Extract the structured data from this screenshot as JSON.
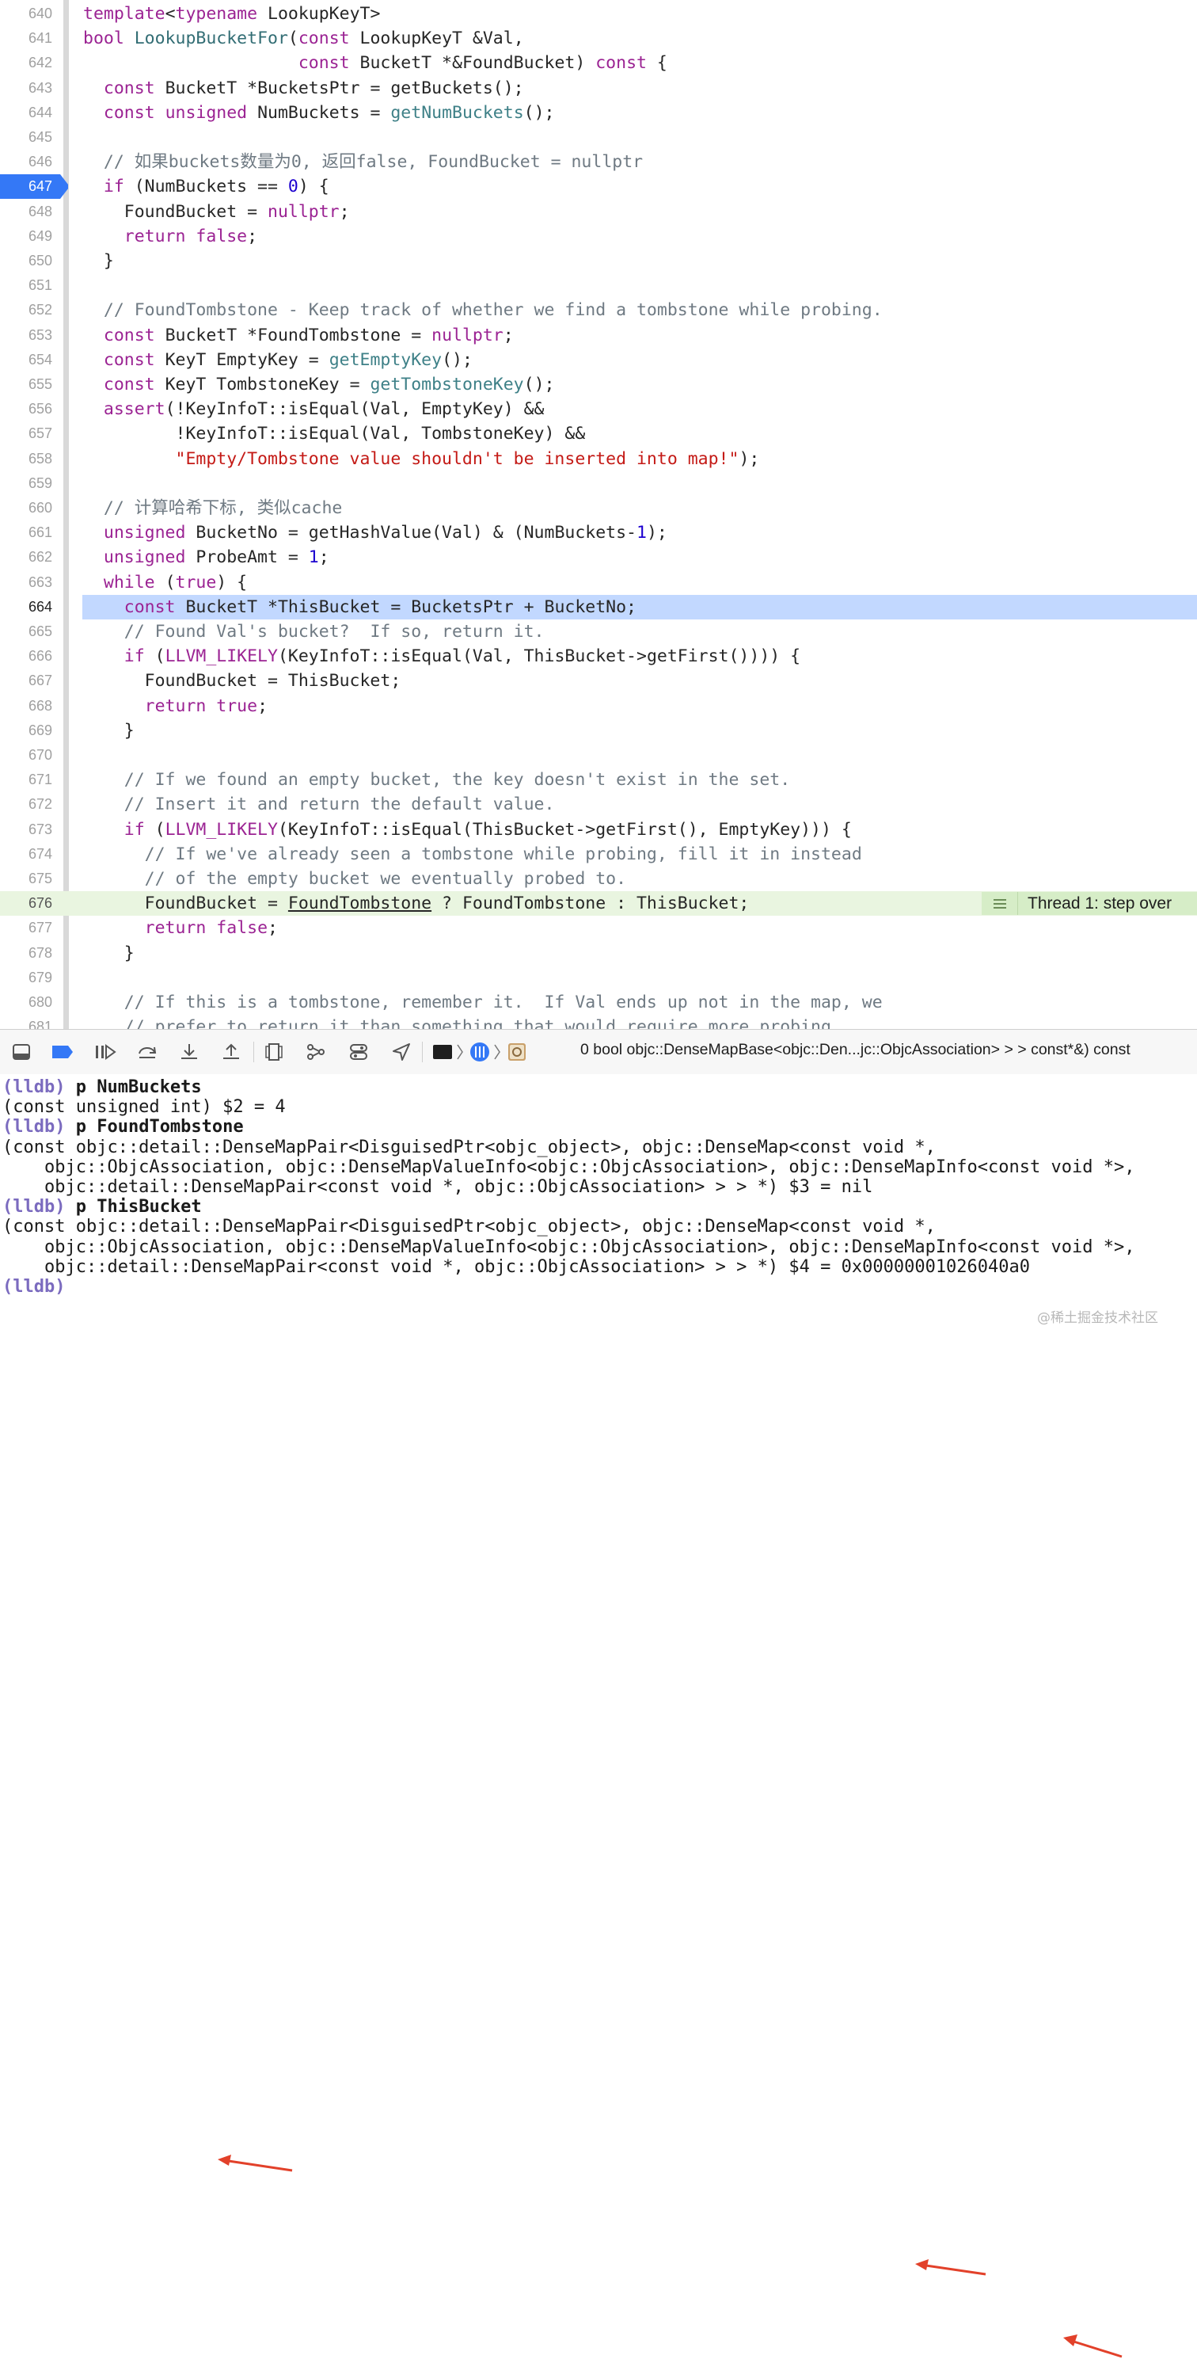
{
  "editor": {
    "lines": [
      {
        "num": "640",
        "code": "<span class=\"k\">template</span>&lt;<span class=\"k\">typename</span> LookupKeyT&gt;"
      },
      {
        "num": "641",
        "code": "<span class=\"k\">bool</span> <span class=\"fb\">LookupBucketFor</span>(<span class=\"k\">const</span> LookupKeyT &amp;Val,"
      },
      {
        "num": "642",
        "code": "                     <span class=\"k\">const</span> BucketT *&amp;FoundBucket) <span class=\"k\">const</span> {"
      },
      {
        "num": "643",
        "code": "  <span class=\"k\">const</span> BucketT *BucketsPtr = getBuckets();"
      },
      {
        "num": "644",
        "code": "  <span class=\"k\">const</span> <span class=\"k\">unsigned</span> NumBuckets = <span class=\"f\">getNumBuckets</span>();"
      },
      {
        "num": "645",
        "code": ""
      },
      {
        "num": "646",
        "code": "  <span class=\"c\">// 如果buckets数量为0, 返回false, FoundBucket = nullptr</span>"
      },
      {
        "num": "647",
        "code": "  <span class=\"k\">if</span> (NumBuckets == <span class=\"n\">0</span>) {"
      },
      {
        "num": "648",
        "code": "    FoundBucket = <span class=\"k\">nullptr</span>;"
      },
      {
        "num": "649",
        "code": "    <span class=\"k\">return</span> <span class=\"k\">false</span>;"
      },
      {
        "num": "650",
        "code": "  }"
      },
      {
        "num": "651",
        "code": ""
      },
      {
        "num": "652",
        "code": "  <span class=\"c\">// FoundTombstone - Keep track of whether we find a tombstone while probing.</span>"
      },
      {
        "num": "653",
        "code": "  <span class=\"k\">const</span> BucketT *FoundTombstone = <span class=\"k\">nullptr</span>;"
      },
      {
        "num": "654",
        "code": "  <span class=\"k\">const</span> KeyT EmptyKey = <span class=\"f\">getEmptyKey</span>();"
      },
      {
        "num": "655",
        "code": "  <span class=\"k\">const</span> KeyT TombstoneKey = <span class=\"f\">getTombstoneKey</span>();"
      },
      {
        "num": "656",
        "code": "  <span class=\"k\">assert</span>(!KeyInfoT::isEqual(Val, EmptyKey) &amp;&amp;"
      },
      {
        "num": "657",
        "code": "         !KeyInfoT::isEqual(Val, TombstoneKey) &amp;&amp;"
      },
      {
        "num": "658",
        "code": "         <span class=\"s\">\"Empty/Tombstone value shouldn't be inserted into map!\"</span>);"
      },
      {
        "num": "659",
        "code": ""
      },
      {
        "num": "660",
        "code": "  <span class=\"c\">// 计算哈希下标, 类似cache</span>"
      },
      {
        "num": "661",
        "code": "  <span class=\"k\">unsigned</span> BucketNo = getHashValue(Val) &amp; (NumBuckets-<span class=\"n\">1</span>);"
      },
      {
        "num": "662",
        "code": "  <span class=\"k\">unsigned</span> ProbeAmt = <span class=\"n\">1</span>;"
      },
      {
        "num": "663",
        "code": "  <span class=\"k\">while</span> (<span class=\"k\">true</span>) {"
      },
      {
        "num": "664",
        "code": "    <span class=\"k\">const</span> BucketT *ThisBucket = BucketsPtr + BucketNo;"
      },
      {
        "num": "665",
        "code": "    <span class=\"c\">// Found Val's bucket?  If so, return it.</span>"
      },
      {
        "num": "666",
        "code": "    <span class=\"k\">if</span> (<span class=\"k\">LLVM_LIKELY</span>(KeyInfoT::isEqual(Val, ThisBucket-&gt;getFirst()))) {"
      },
      {
        "num": "667",
        "code": "      FoundBucket = ThisBucket;"
      },
      {
        "num": "668",
        "code": "      <span class=\"k\">return</span> <span class=\"k\">true</span>;"
      },
      {
        "num": "669",
        "code": "    }"
      },
      {
        "num": "670",
        "code": ""
      },
      {
        "num": "671",
        "code": "    <span class=\"c\">// If we found an empty bucket, the key doesn't exist in the set.</span>"
      },
      {
        "num": "672",
        "code": "    <span class=\"c\">// Insert it and return the default value.</span>"
      },
      {
        "num": "673",
        "code": "    <span class=\"k\">if</span> (<span class=\"k\">LLVM_LIKELY</span>(KeyInfoT::isEqual(ThisBucket-&gt;getFirst(), EmptyKey))) {"
      },
      {
        "num": "674",
        "code": "      <span class=\"c\">// If we've already seen a tombstone while probing, fill it in instead</span>"
      },
      {
        "num": "675",
        "code": "      <span class=\"c\">// of the empty bucket we eventually probed to.</span>"
      },
      {
        "num": "676",
        "code": "      FoundBucket = <span class=\"u\">FoundTombstone</span> ? FoundTombstone : ThisBucket;"
      },
      {
        "num": "677",
        "code": "      <span class=\"k\">return</span> <span class=\"k\">false</span>;"
      },
      {
        "num": "678",
        "code": "    }"
      },
      {
        "num": "679",
        "code": ""
      },
      {
        "num": "680",
        "code": "    <span class=\"c\">// If this is a tombstone, remember it.  If Val ends up not in the map, we</span>"
      },
      {
        "num": "681",
        "code": "    <span class=\"c\">// prefer to return it than something that would require more probing.</span>"
      }
    ],
    "breakpoint_line": "647",
    "current_line": "664",
    "pc_line": "676",
    "thread_badge": "Thread 1: step over"
  },
  "debug_toolbar": {
    "frame_label": "0 bool objc::DenseMapBase<objc::Den...jc::ObjcAssociation> > > const*&) const"
  },
  "console": {
    "lines": [
      {
        "prompt": "(lldb)",
        "text": " p NumBuckets"
      },
      {
        "prompt": "",
        "text": "(const unsigned int) $2 = 4"
      },
      {
        "prompt": "(lldb)",
        "text": " p FoundTombstone"
      },
      {
        "prompt": "",
        "text": "(const objc::detail::DenseMapPair<DisguisedPtr<objc_object>, objc::DenseMap<const void *,"
      },
      {
        "prompt": "",
        "text": "    objc::ObjcAssociation, objc::DenseMapValueInfo<objc::ObjcAssociation>, objc::DenseMapInfo<const void *>,"
      },
      {
        "prompt": "",
        "text": "    objc::detail::DenseMapPair<const void *, objc::ObjcAssociation> > > *) $3 = nil"
      },
      {
        "prompt": "(lldb)",
        "text": " p ThisBucket"
      },
      {
        "prompt": "",
        "text": "(const objc::detail::DenseMapPair<DisguisedPtr<objc_object>, objc::DenseMap<const void *,"
      },
      {
        "prompt": "",
        "text": "    objc::ObjcAssociation, objc::DenseMapValueInfo<objc::ObjcAssociation>, objc::DenseMapInfo<const void *>,"
      },
      {
        "prompt": "",
        "text": "    objc::detail::DenseMapPair<const void *, objc::ObjcAssociation> > > *) $4 = 0x00000001026040a0"
      },
      {
        "prompt": "(lldb)",
        "text": ""
      }
    ],
    "watermark": "@稀土掘金技术社区"
  },
  "colors": {
    "breakpoint": "#3478f6",
    "current_line_highlight": "#c2d8ff",
    "pc_line_bg": "#e9f5e0",
    "keyword": "#9b2393",
    "comment": "#6f7a83",
    "string": "#c41a16",
    "number": "#1c00cf",
    "arrow": "#e2412a"
  }
}
